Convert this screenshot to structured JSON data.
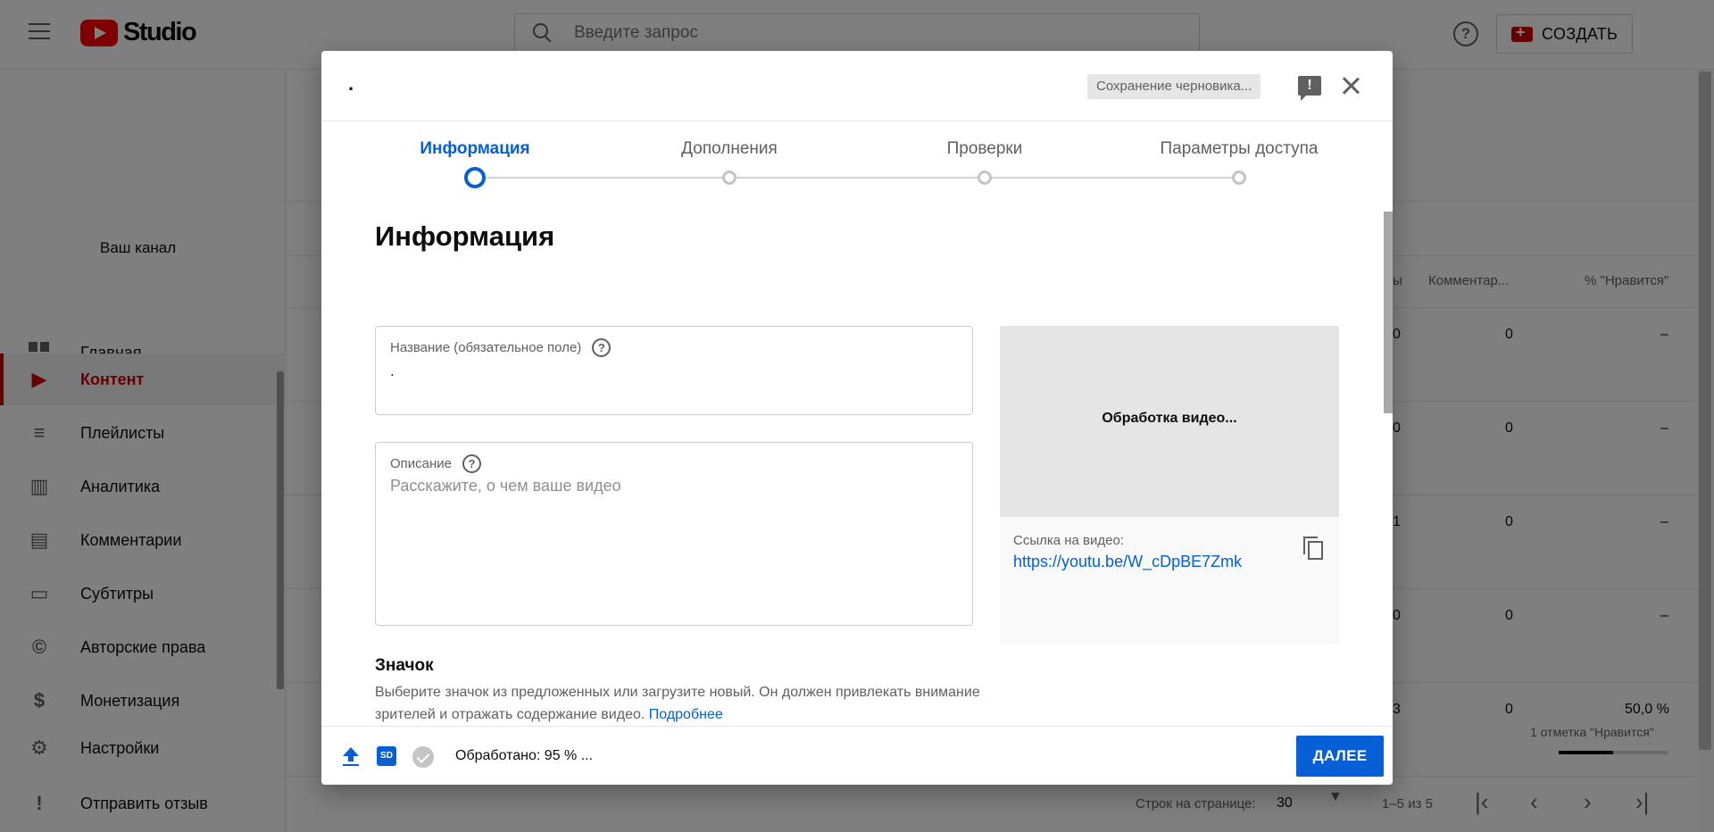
{
  "app": {
    "logo_text": "Studio",
    "search_placeholder": "Введите запрос",
    "help_glyph": "?",
    "create_label": "СОЗДАТЬ"
  },
  "sidebar": {
    "channel_label": "Ваш канал",
    "items": [
      {
        "label": "Главная",
        "icon": "dashboard-icon",
        "active": false
      },
      {
        "label": "Контент",
        "icon": "content-icon",
        "active": true
      },
      {
        "label": "Плейлисты",
        "icon": "playlist-icon",
        "active": false
      },
      {
        "label": "Аналитика",
        "icon": "analytics-icon",
        "active": false
      },
      {
        "label": "Комментарии",
        "icon": "comments-icon",
        "active": false
      },
      {
        "label": "Субтитры",
        "icon": "subtitles-icon",
        "active": false
      },
      {
        "label": "Авторские права",
        "icon": "copyright-icon",
        "active": false
      },
      {
        "label": "Монетизация",
        "icon": "dollar-icon",
        "active": false
      },
      {
        "label": "Настройки",
        "icon": "gear-icon",
        "active": false
      },
      {
        "label": "Отправить отзыв",
        "icon": "feedback-icon",
        "active": false
      }
    ]
  },
  "table": {
    "headers": {
      "views_partial": "ы",
      "comments": "Комментар...",
      "likes": "% \"Нравится\""
    },
    "rows": [
      {
        "views": "0",
        "comments": "0",
        "likes": "–"
      },
      {
        "views": "0",
        "comments": "0",
        "likes": "–"
      },
      {
        "views": "1",
        "comments": "0",
        "likes": "–"
      },
      {
        "views": "0",
        "comments": "0",
        "likes": "–"
      },
      {
        "views": "3",
        "comments": "0",
        "likes": "50,0 %",
        "likes_sub": "1 отметка \"Нравится\"",
        "likes_fraction": 0.5
      }
    ],
    "footer": {
      "rows_per_page_label": "Строк на странице:",
      "rows_per_page_value": "30",
      "range": "1–5 из 5"
    }
  },
  "modal": {
    "title": ".",
    "draft_status": "Сохранение черновика...",
    "steps": [
      {
        "label": "Информация",
        "active": true
      },
      {
        "label": "Дополнения",
        "active": false
      },
      {
        "label": "Проверки",
        "active": false
      },
      {
        "label": "Параметры доступа",
        "active": false
      }
    ],
    "heading": "Информация",
    "title_field": {
      "label": "Название (обязательное поле)",
      "value": "."
    },
    "description_field": {
      "label": "Описание",
      "placeholder": "Расскажите, о чем ваше видео"
    },
    "icon_section": {
      "heading": "Значок",
      "description": "Выберите значок из предложенных или загрузите новый. Он должен привлекать внимание зрителей и отражать содержание видео.",
      "more_link": "Подробнее"
    },
    "preview": {
      "status": "Обработка видео...",
      "link_label": "Ссылка на видео:",
      "link_url": "https://youtu.be/W_cDpBE7Zmk"
    },
    "footer": {
      "sd_badge": "SD",
      "status": "Обработано: 95 % ...",
      "next_label": "ДАЛЕЕ"
    }
  }
}
